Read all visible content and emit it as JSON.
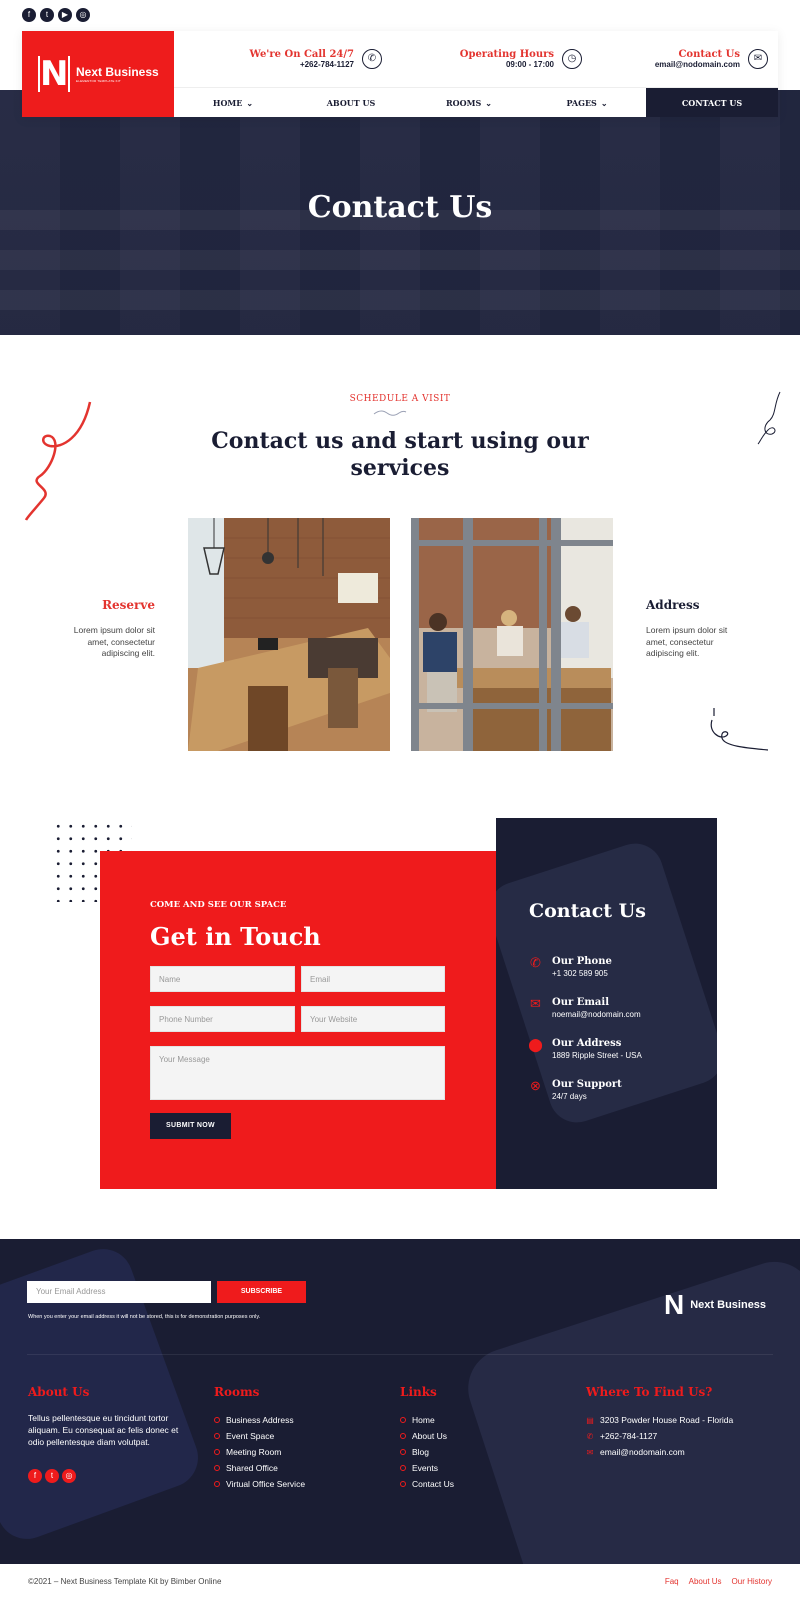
{
  "social_top": [
    "facebook-icon",
    "twitter-icon",
    "youtube-icon",
    "instagram-icon"
  ],
  "brand": {
    "name": "Next Business",
    "tagline": "ELEMENTOR TEMPLATE KIT",
    "color": "#ee1c1c",
    "navy": "#1a1d33"
  },
  "header": {
    "call": {
      "label": "We're On Call 24/7",
      "value": "+262-784-1127",
      "icon": "phone-icon"
    },
    "hours": {
      "label": "Operating Hours",
      "value": "09:00 - 17:00",
      "icon": "clock-icon"
    },
    "contact": {
      "label": "Contact Us",
      "value": "email@nodomain.com",
      "icon": "mail-icon"
    }
  },
  "nav": [
    {
      "label": "HOME",
      "dropdown": true
    },
    {
      "label": "ABOUT US",
      "dropdown": false
    },
    {
      "label": "ROOMS",
      "dropdown": true
    },
    {
      "label": "PAGES",
      "dropdown": true
    },
    {
      "label": "CONTACT US",
      "dropdown": false,
      "active": true
    }
  ],
  "hero": {
    "title": "Contact Us"
  },
  "visit": {
    "eyebrow": "SCHEDULE A VISIT",
    "title": "Contact us and start using our services",
    "reserve": {
      "title": "Reserve",
      "body": "Lorem ipsum dolor sit amet, consectetur adipiscing elit."
    },
    "address": {
      "title": "Address",
      "body": "Lorem ipsum dolor sit amet, consectetur adipiscing elit."
    }
  },
  "touch": {
    "eyebrow": "COME AND SEE OUR SPACE",
    "title": "Get in Touch",
    "placeholders": {
      "name": "Name",
      "email": "Email",
      "phone": "Phone Number",
      "website": "Your Website",
      "message": "Your Message"
    },
    "submit": "SUBMIT NOW"
  },
  "contact_panel": {
    "title": "Contact Us",
    "items": [
      {
        "icon": "phone-icon",
        "label": "Our Phone",
        "value": "+1 302 589 905"
      },
      {
        "icon": "envelope-icon",
        "label": "Our Email",
        "value": "noemail@nodomain.com"
      },
      {
        "icon": "location-pin-icon",
        "label": "Our Address",
        "value": "1889 Ripple Street - USA"
      },
      {
        "icon": "support-icon",
        "label": "Our Support",
        "value": "24/7 days"
      }
    ]
  },
  "footer": {
    "newsletter": {
      "placeholder": "Your Email Address",
      "button": "SUBSCRIBE",
      "disclaimer": "When you enter your email address it will not be stored, this is for demonstration purposes only."
    },
    "about": {
      "title": "About Us",
      "body": "Tellus pellentesque eu tincidunt tortor aliquam. Eu consequat ac felis donec et odio pellentesque diam volutpat.",
      "social": [
        "facebook-icon",
        "twitter-icon",
        "instagram-icon"
      ]
    },
    "rooms": {
      "title": "Rooms",
      "items": [
        "Business Address",
        "Event Space",
        "Meeting Room",
        "Shared Office",
        "Virtual Office Service"
      ]
    },
    "links": {
      "title": "Links",
      "items": [
        "Home",
        "About Us",
        "Blog",
        "Events",
        "Contact Us"
      ]
    },
    "find": {
      "title": "Where To Find Us?",
      "items": [
        {
          "icon": "building-icon",
          "text": "3203 Powder House Road - Florida"
        },
        {
          "icon": "phone-icon",
          "text": "+262-784-1127"
        },
        {
          "icon": "mail-icon",
          "text": "email@nodomain.com"
        }
      ]
    }
  },
  "bottom": {
    "copyright": "©2021 – Next Business Template Kit by Bimber Online",
    "links": [
      "Faq",
      "About Us",
      "Our History"
    ]
  }
}
